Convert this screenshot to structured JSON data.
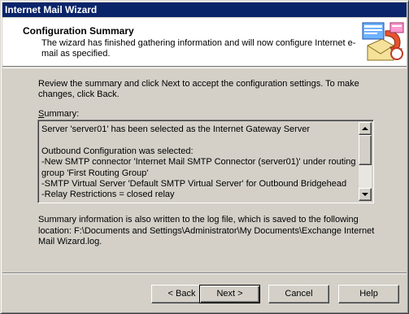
{
  "window": {
    "title": "Internet Mail Wizard"
  },
  "header": {
    "title": "Configuration Summary",
    "description": "The wizard has finished gathering information and will now configure Internet e-mail as specified."
  },
  "body": {
    "intro": "Review the summary and click Next to accept the configuration settings.  To make changes, click Back.",
    "summary_label_prefix": "S",
    "summary_label_rest": "ummary:",
    "summary_text": "Server 'server01' has been selected as the Internet Gateway Server\n\nOutbound Configuration was selected:\n-New SMTP connector 'Internet Mail SMTP Connector (server01)' under routing group 'First Routing Group'\n-SMTP Virtual Server 'Default SMTP Virtual Server' for Outbound Bridgehead\n-Relay Restrictions = closed relay",
    "log_info": "Summary information is also written to the log file, which is saved to the following location: F:\\Documents and Settings\\Administrator\\My Documents\\Exchange Internet Mail Wizard.log."
  },
  "buttons": {
    "back": "< Back",
    "next": "Next >",
    "cancel": "Cancel",
    "help": "Help"
  },
  "colors": {
    "titlebar": "#0a246a",
    "face": "#d4d0c8",
    "header_bg": "#ffffff"
  },
  "icons": {
    "header": "mail-wizard-icon",
    "scroll_up": "arrow-up-icon",
    "scroll_down": "arrow-down-icon"
  }
}
